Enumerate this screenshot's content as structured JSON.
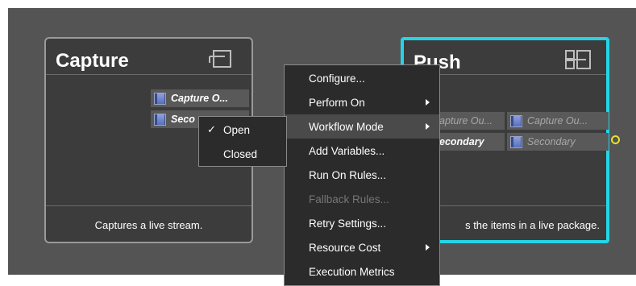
{
  "nodes": {
    "capture": {
      "title": "Capture",
      "ports": [
        "Capture O...",
        "Seco"
      ],
      "description": "Captures a live stream."
    },
    "push": {
      "title": "Push",
      "ports_left": [
        "apture Ou...",
        "econdary"
      ],
      "ports_right": [
        "Capture Ou...",
        "Secondary"
      ],
      "description": "s the items in a live package."
    }
  },
  "context_menu": {
    "items": [
      {
        "label": "Configure..."
      },
      {
        "label": "Perform On"
      },
      {
        "label": "Workflow Mode"
      },
      {
        "label": "Add Variables..."
      },
      {
        "label": "Run On Rules..."
      },
      {
        "label": "Fallback Rules..."
      },
      {
        "label": "Retry Settings..."
      },
      {
        "label": "Resource Cost"
      },
      {
        "label": "Execution Metrics"
      }
    ]
  },
  "submenu": {
    "items": [
      {
        "label": "Open",
        "check": "✓"
      },
      {
        "label": "Closed",
        "check": ""
      }
    ]
  },
  "colors": {
    "canvas": "#545454",
    "selection_border": "#25d4e6",
    "connector": "#e6e32a"
  }
}
